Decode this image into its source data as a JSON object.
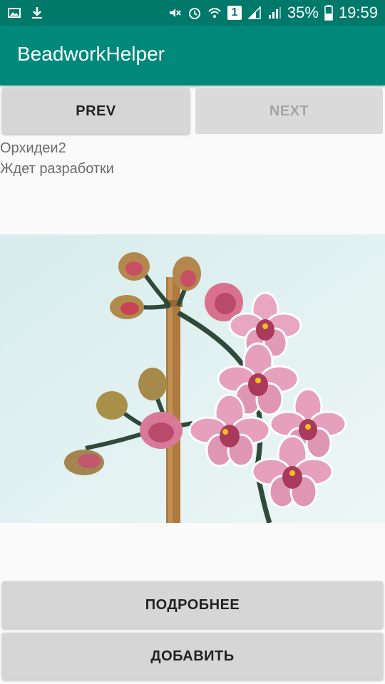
{
  "status_bar": {
    "battery": "35%",
    "time": "19:59",
    "sim_badge": "1",
    "icons": [
      "gallery-icon",
      "download-icon",
      "mute-icon",
      "alarm-icon",
      "wifi-icon",
      "sim-icon",
      "signal-icon",
      "signal-icon",
      "battery-icon"
    ]
  },
  "app": {
    "title": "BeadworkHelper",
    "accent": "#00897b",
    "status_color": "#00796b"
  },
  "nav": {
    "prev_label": "PREV",
    "next_label": "NEXT"
  },
  "item": {
    "name": "Орхидеи2",
    "status": "Ждет разработки"
  },
  "actions": {
    "more_label": "ПОДРОБНЕЕ",
    "add_label": "ДОБАВИТЬ"
  }
}
